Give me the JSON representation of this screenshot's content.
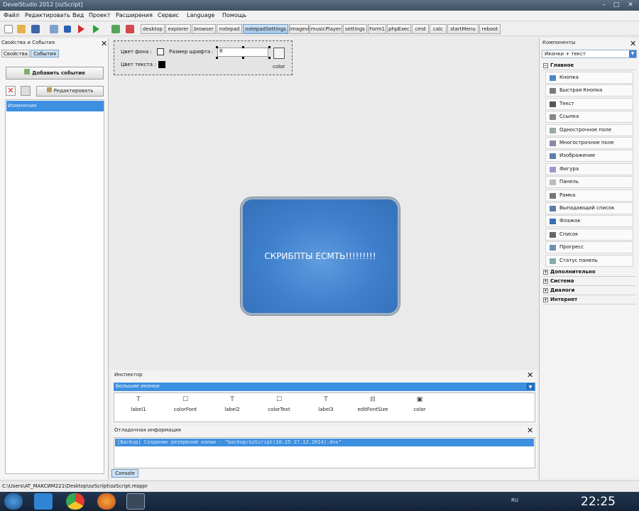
{
  "window": {
    "title": "DevelStudio 2012 [ozScript]",
    "buttons": [
      "–",
      "□",
      "✕"
    ]
  },
  "menu": [
    "Файл",
    "Редактировать",
    "Вид",
    "Проект",
    "Расширения",
    "Сервис",
    "Language",
    "Помощь"
  ],
  "form_tabs": [
    {
      "label": "desktop",
      "active": false
    },
    {
      "label": "explorer",
      "active": false
    },
    {
      "label": "browser",
      "active": false
    },
    {
      "label": "notepad",
      "active": false
    },
    {
      "label": "notepadSettings",
      "active": true
    },
    {
      "label": "imageview",
      "active": false
    },
    {
      "label": "musicPlayer",
      "active": false
    },
    {
      "label": "settings",
      "active": false
    },
    {
      "label": "Form1",
      "active": false
    },
    {
      "label": "phpExec",
      "active": false
    },
    {
      "label": "cmd",
      "active": false
    },
    {
      "label": "calc",
      "active": false
    },
    {
      "label": "startMenu",
      "active": false
    },
    {
      "label": "reboot",
      "active": false
    }
  ],
  "left_panel": {
    "title": "Свойства и События",
    "tabs": [
      "Свойства",
      "События"
    ],
    "active_tab": "События",
    "add_event_button": "Добавить событие",
    "edit_button": "Редактировать",
    "events": [
      "Изменение"
    ]
  },
  "form": {
    "bg_color_label": "Цвет фона :",
    "font_size_label": "Размер шрифта :",
    "font_size_value": "8",
    "text_color_label": "Цвет текста :",
    "color_button_caption": "color",
    "big_button_text": "СКРИБПТЫ ЕСМТЬ!!!!!!!!!"
  },
  "right_panel": {
    "title": "Компоненты",
    "view_mode": "Иконки + текст",
    "groups": [
      {
        "label": "Главное",
        "expanded": true
      },
      {
        "label": "Дополнительно",
        "expanded": false
      },
      {
        "label": "Система",
        "expanded": false
      },
      {
        "label": "Диалоги",
        "expanded": false
      },
      {
        "label": "Интернет",
        "expanded": false
      }
    ],
    "components": [
      {
        "label": "Кнопка",
        "icon": "button-icon"
      },
      {
        "label": "Быстрая Кнопка",
        "icon": "speedbutton-icon"
      },
      {
        "label": "Текст",
        "icon": "text-icon"
      },
      {
        "label": "Ссылка",
        "icon": "link-icon"
      },
      {
        "label": "Однострочное поле",
        "icon": "edit-icon"
      },
      {
        "label": "Многострочное поле",
        "icon": "memo-icon"
      },
      {
        "label": "Изображение",
        "icon": "image-icon"
      },
      {
        "label": "Фигура",
        "icon": "shape-icon"
      },
      {
        "label": "Панель",
        "icon": "panel-icon"
      },
      {
        "label": "Рамка",
        "icon": "frame-icon"
      },
      {
        "label": "Выпадающий список",
        "icon": "combobox-icon"
      },
      {
        "label": "Флажок",
        "icon": "checkbox-icon"
      },
      {
        "label": "Список",
        "icon": "listbox-icon"
      },
      {
        "label": "Прогресс",
        "icon": "progress-icon"
      },
      {
        "label": "Статус панель",
        "icon": "statusbar-icon"
      }
    ]
  },
  "inspector": {
    "title": "Инспектор",
    "view_mode": "Большие иконки",
    "items": [
      {
        "label": "label1",
        "icon": "label-icon"
      },
      {
        "label": "colorFont",
        "icon": "checkbox-icon"
      },
      {
        "label": "label2",
        "icon": "label-icon"
      },
      {
        "label": "colorText",
        "icon": "checkbox-icon"
      },
      {
        "label": "label3",
        "icon": "label-icon"
      },
      {
        "label": "editFontSize",
        "icon": "edit-icon"
      },
      {
        "label": "color",
        "icon": "colorpicker-icon"
      }
    ]
  },
  "debug": {
    "title": "Отладочная информация",
    "lines": [
      "[Backup] Создание резервной копии - \"backup/ozScript(10.25 27.12.2014).dvs\""
    ],
    "tab": "Console"
  },
  "status_bar": {
    "path": "C:\\Users\\AT_MAKCИM221\\Desktop\\ozScript\\ozScript.msppr"
  },
  "taskbar": {
    "lang": "RU",
    "clock": "22:25",
    "apps": [
      "windows-start-icon",
      "explorer-icon",
      "chrome-icon",
      "firefox-icon",
      "develstudio-icon"
    ]
  },
  "colors": {
    "accent": "#3d8fe0",
    "form_button": "#3f7fcd",
    "taskbar": "#1a2b44"
  }
}
